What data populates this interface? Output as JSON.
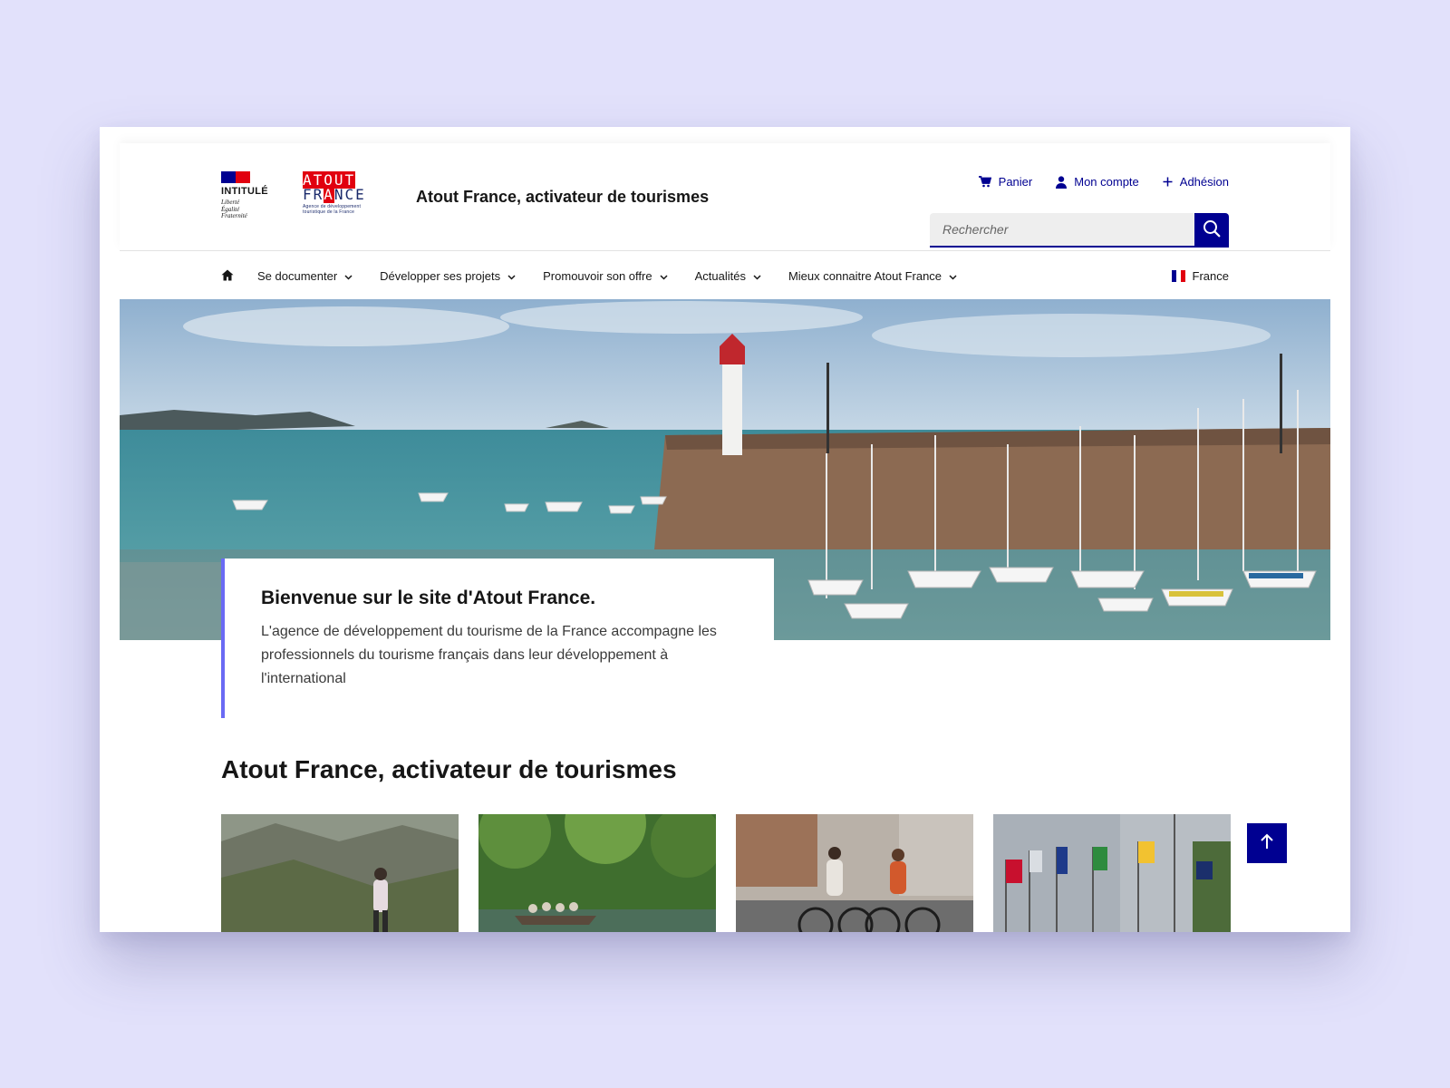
{
  "header": {
    "marianne": {
      "name": "INTITULÉ",
      "motto": [
        "Liberté",
        "Égalité",
        "Fraternité"
      ]
    },
    "logo": {
      "line1": "ATOUT",
      "line2_pre": "FR",
      "line2_hl": "A",
      "line2_post": "NCE",
      "tagline": [
        "Agence de développement",
        "touristique de la France"
      ]
    },
    "site_title": "Atout France, activateur de tourismes",
    "quick_links": [
      {
        "label": "Panier",
        "icon": "cart-icon"
      },
      {
        "label": "Mon compte",
        "icon": "user-icon"
      },
      {
        "label": "Adhésion",
        "icon": "plus-icon"
      }
    ],
    "search": {
      "placeholder": "Rechercher",
      "value": ""
    }
  },
  "nav": {
    "items": [
      {
        "label": "Se documenter"
      },
      {
        "label": "Développer ses projets"
      },
      {
        "label": "Promouvoir son offre"
      },
      {
        "label": "Actualités"
      },
      {
        "label": "Mieux connaitre Atout France"
      }
    ],
    "language": "France"
  },
  "hero": {
    "heading": "Bienvenue sur le site d'Atout France.",
    "text": "L'agence de développement du tourisme de la France accompagne les professionnels du tourisme français dans leur développement à l'international"
  },
  "section": {
    "title": "Atout France, activateur de tourismes"
  },
  "colors": {
    "primary": "#000091",
    "accent": "#6a6af4",
    "red": "#e1000f",
    "background": "#e2e1fb"
  }
}
